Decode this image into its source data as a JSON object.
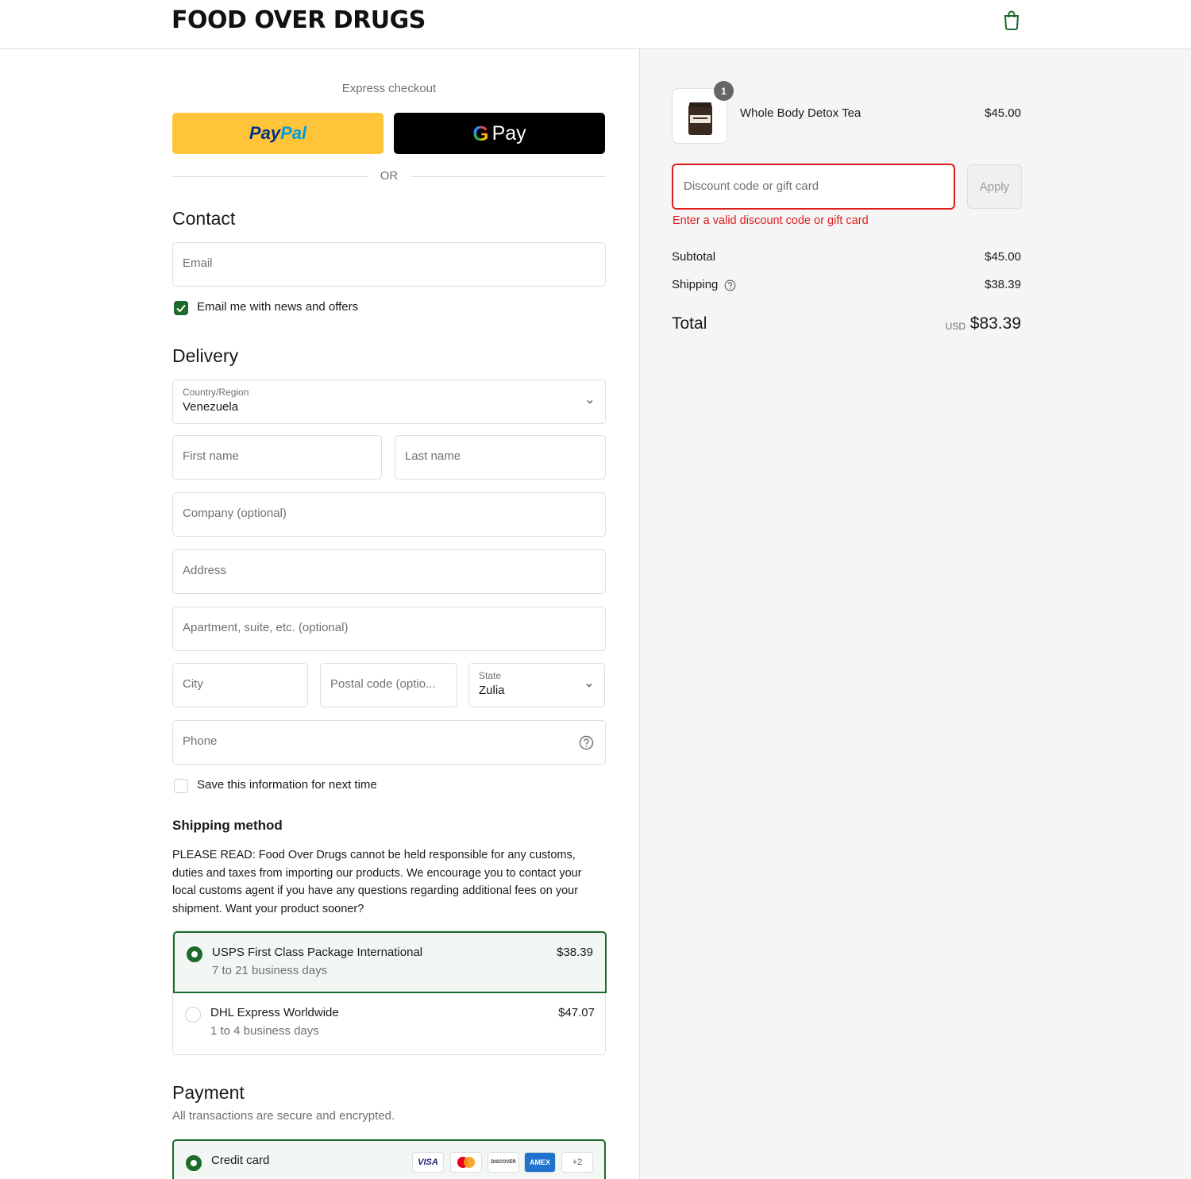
{
  "header": {
    "brand": "FOOD OVER DRUGS"
  },
  "express": {
    "label": "Express checkout",
    "paypal_a": "Pay",
    "paypal_b": "Pal",
    "gpay_g": "G",
    "gpay_text": "Pay",
    "or": "OR"
  },
  "contact": {
    "title": "Contact",
    "email_placeholder": "Email",
    "newsletter_label": "Email me with news and offers",
    "newsletter_checked": true
  },
  "delivery": {
    "title": "Delivery",
    "country_label": "Country/Region",
    "country_value": "Venezuela",
    "first_name": "First name",
    "last_name": "Last name",
    "company": "Company (optional)",
    "address": "Address",
    "apartment": "Apartment, suite, etc. (optional)",
    "city": "City",
    "postal": "Postal code (optio...",
    "state_label": "State",
    "state_value": "Zulia",
    "phone": "Phone",
    "save_label": "Save this information for next time"
  },
  "shipping": {
    "title": "Shipping method",
    "notice": "PLEASE READ: Food Over Drugs cannot be held responsible for any customs, duties and taxes from importing our products. We encourage you to contact your local customs agent if you have any questions regarding additional fees on your shipment. Want your product sooner?",
    "options": [
      {
        "name": "USPS First Class Package International",
        "days": "7 to 21 business days",
        "price": "$38.39",
        "selected": true
      },
      {
        "name": "DHL Express Worldwide",
        "days": "1 to 4 business days",
        "price": "$47.07",
        "selected": false
      }
    ]
  },
  "payment": {
    "title": "Payment",
    "subtitle": "All transactions are secure and encrypted.",
    "method": "Credit card",
    "cards": [
      "VISA",
      "mastercard-icon",
      "DISCOVER",
      "AMEX",
      "+2"
    ]
  },
  "summary": {
    "product_name": "Whole Body Detox Tea",
    "product_price": "$45.00",
    "quantity": "1",
    "discount_placeholder": "Discount code or gift card",
    "apply_label": "Apply",
    "discount_error": "Enter a valid discount code or gift card",
    "subtotal_label": "Subtotal",
    "subtotal_value": "$45.00",
    "shipping_label": "Shipping",
    "shipping_value": "$38.39",
    "total_label": "Total",
    "currency": "USD",
    "total_value": "$83.39"
  },
  "colors": {
    "accent": "#1c6b2a",
    "error": "#dd1d1d",
    "paypal_yellow": "#ffc439"
  }
}
